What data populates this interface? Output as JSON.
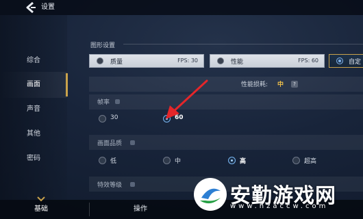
{
  "header": {
    "title": "设置"
  },
  "sidebar": {
    "items": [
      {
        "label": "综合"
      },
      {
        "label": "画面"
      },
      {
        "label": "声音"
      },
      {
        "label": "其他"
      },
      {
        "label": "密码"
      }
    ],
    "active_index": 1
  },
  "graphics": {
    "section_title": "图形设置",
    "presets": [
      {
        "label": "质量",
        "fps": "FPS: 30",
        "selected": false
      },
      {
        "label": "性能",
        "fps": "FPS: 60",
        "selected": false
      },
      {
        "label": "自定",
        "selected": true
      }
    ],
    "performance_cost_label": "性能损耗:",
    "performance_cost_value": "中"
  },
  "frame_rate": {
    "title": "帧率",
    "options": [
      {
        "label": "30",
        "checked": false
      },
      {
        "label": "60",
        "checked": true
      }
    ]
  },
  "image_quality": {
    "title": "画面品质",
    "options": [
      {
        "label": "低",
        "checked": false
      },
      {
        "label": "中",
        "checked": false
      },
      {
        "label": "高",
        "checked": true
      },
      {
        "label": "超高",
        "checked": false
      }
    ]
  },
  "effects": {
    "title": "特效等级"
  },
  "bottom_tabs": [
    {
      "label": "基础"
    },
    {
      "label": "操作"
    }
  ],
  "watermark": {
    "text": "安勤游戏网",
    "url": "www.hzaccw.com"
  },
  "colors": {
    "accent_gold": "#c9a24b",
    "selected_blue": "#79b4ef",
    "arrow_red": "#e4262a"
  }
}
